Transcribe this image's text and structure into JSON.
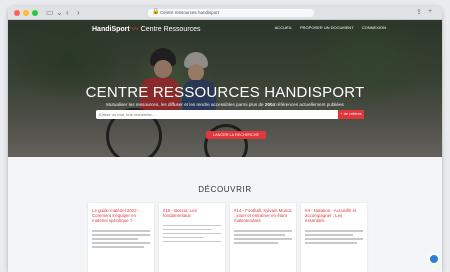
{
  "browser": {
    "url": "Centre ressources handisport"
  },
  "topnav": {
    "logo_brand": "HandiSport",
    "logo_suffix": "Centre Ressources",
    "links": [
      "ACCUEIL",
      "PROPOSER UN DOCUMENT",
      "CONNEXION"
    ]
  },
  "hero": {
    "title": "CENTRE RESSOURCES HANDISPORT",
    "subtitle_prefix": "Mutualiser les ressources, les diffuser et les rendre accessibles parmi plus de",
    "subtitle_count": "2004",
    "subtitle_suffix": "références actuellement publiées",
    "search_placeholder": "Entrez un mot, une recherche...",
    "criteria_label": "+ de critères",
    "launch_label": "LANCER LA RECHERCHE"
  },
  "discover": {
    "title": "DÉCOUVRIR",
    "cards": [
      {
        "title": "Le guide matériel 2022 - Comment s'équiper en matériel spécifique ?"
      },
      {
        "title": "#15 - Boccia, Les fondamentaux"
      },
      {
        "title": "#14 - Football, Sylvain Munoz : jouer et entraîner en étant malentendant"
      },
      {
        "title": "#4 - Natation - Accueillir et accompagner : Les essentiels"
      }
    ]
  },
  "colors": {
    "accent": "#e0363c",
    "chat": "#2f7cd8"
  }
}
